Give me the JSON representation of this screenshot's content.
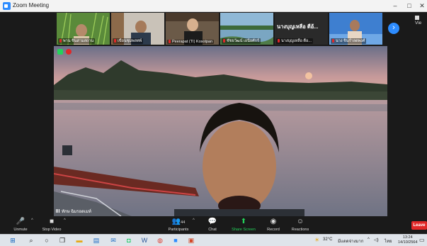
{
  "window": {
    "title": "Zoom Meeting",
    "minimize_glyph": "–",
    "maximize_glyph": "□",
    "close_glyph": "✕"
  },
  "gallery": {
    "view_label": "Vie",
    "next_glyph": "›",
    "tiles": [
      {
        "name": "พาน ชินสามสถาน"
      },
      {
        "name": "เขื่อนชุมพลทพ์"
      },
      {
        "name": "Peerapat (TI) Kosotpan"
      },
      {
        "name": "ชัชยวัฒน์ เยนียศักร์"
      },
      {
        "name": "นางบุญเหลือ ตือ...",
        "overlay_text": "นางบุญเหลือ  ตือ้..."
      },
      {
        "name": "นาง ชินรำลดพงศ์"
      }
    ]
  },
  "speaker": {
    "name": "ทักษ ฉิมรอดเมท์"
  },
  "toolbar": {
    "unmute": "Unmute",
    "stop_video": "Stop Video",
    "participants": "Participants",
    "participants_count": "44",
    "chat": "Chat",
    "share_screen": "Share Screen",
    "record": "Record",
    "reactions": "Reactions",
    "leave": "Leave"
  },
  "taskbar": {
    "weather": "32°C",
    "weather_desc": "มีแดดจ่างมาก",
    "lang": "ไทย",
    "time": "13:24",
    "date": "14/10/2564"
  },
  "colors": {
    "zoom_blue": "#2d8cff",
    "leave_red": "#e02828",
    "share_green": "#23d35a"
  },
  "icons": [
    "zoom-app-icon",
    "microphone-icon",
    "video-icon",
    "participants-icon",
    "chat-icon",
    "share-screen-icon",
    "record-icon",
    "reactions-icon",
    "windows-start-icon",
    "search-icon",
    "task-view-icon",
    "file-explorer-icon",
    "store-icon",
    "mail-icon",
    "line-icon",
    "word-icon",
    "chrome-icon",
    "zoom-taskbar-icon",
    "photos-icon",
    "weather-icon",
    "wifi-icon",
    "speaker-icon",
    "notification-icon"
  ]
}
